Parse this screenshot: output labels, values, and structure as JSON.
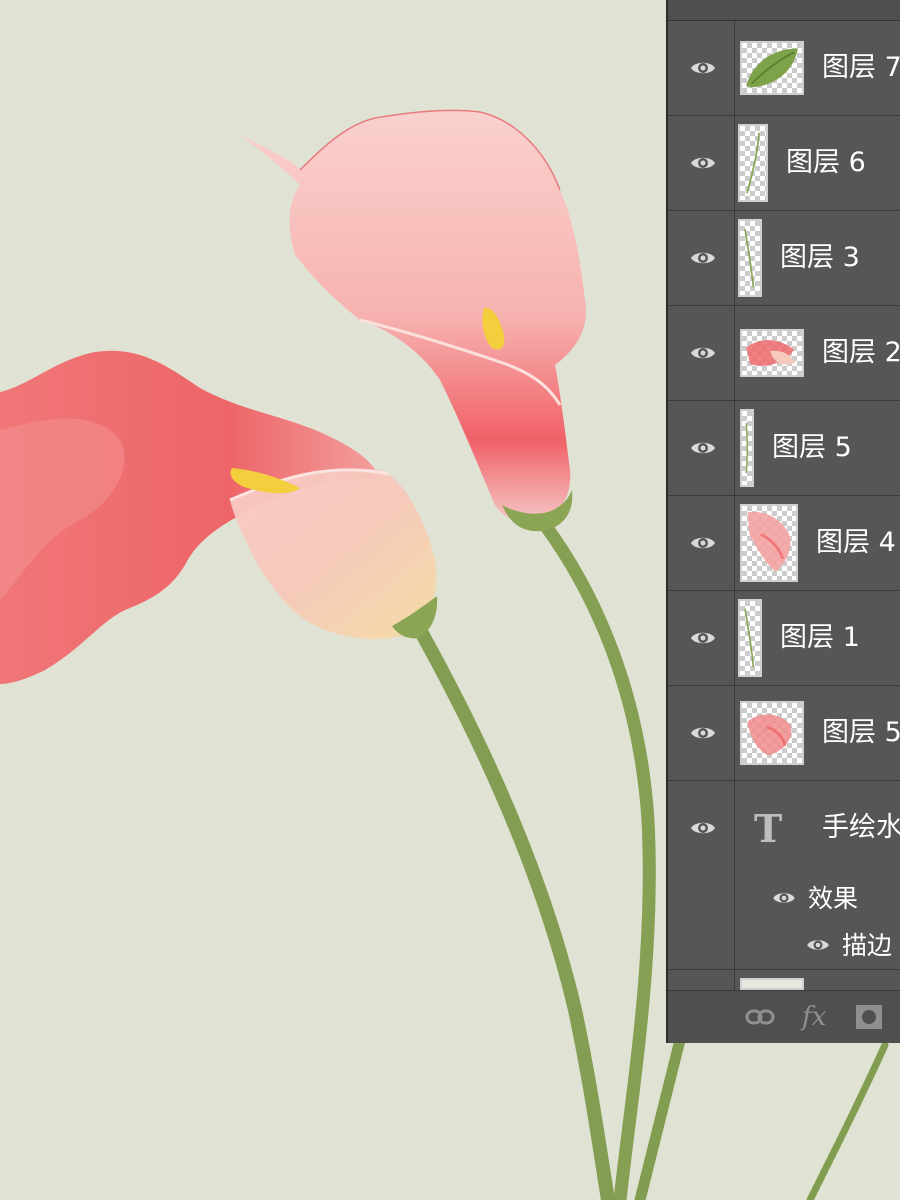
{
  "layers_panel": {
    "layers": [
      {
        "name": "图层 7",
        "thumb": "leaf-thumbnail"
      },
      {
        "name": "图层 6",
        "thumb": "stem-thumbnail"
      },
      {
        "name": "图层 3",
        "thumb": "stem-thumbnail"
      },
      {
        "name": "图层 2",
        "thumb": "flower-thumbnail"
      },
      {
        "name": "图层 5",
        "thumb": "stem-thumbnail"
      },
      {
        "name": "图层 4",
        "thumb": "flower-thumbnail"
      },
      {
        "name": "图层 1",
        "thumb": "stem-thumbnail"
      },
      {
        "name": "图层 5",
        "thumb": "flower-thumbnail"
      }
    ],
    "text_layer": {
      "name": "手绘水",
      "effects_label": "效果",
      "stroke_label": "描边"
    },
    "bottom_bar": {
      "link_icon": "link-icon",
      "fx_label": "fx",
      "mask_icon": "mask-icon"
    }
  },
  "colors": {
    "canvas_background": "#e0e3d4",
    "panel_background": "#555555",
    "petal_red": "#ee5a5e",
    "petal_pink": "#f7c4c2",
    "stem_green": "#7d9a4b",
    "spadix_yellow": "#f3cf3e"
  }
}
